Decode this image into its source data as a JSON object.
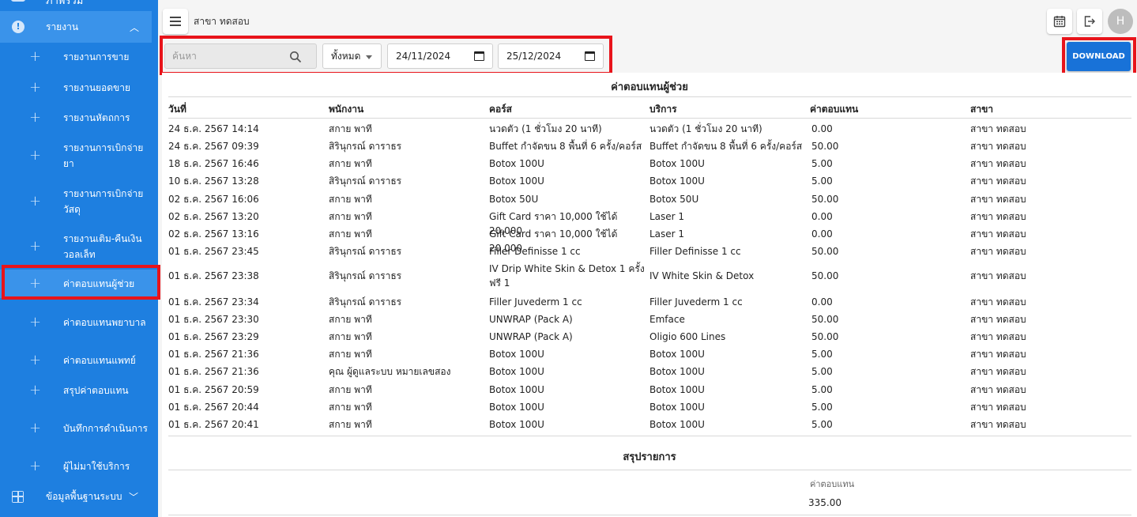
{
  "sidebar": {
    "top_partial_label": "ภาพรวม",
    "group_reports": "รายงาน",
    "items": [
      {
        "label": "รายงานการขาย"
      },
      {
        "label": "รายงานยอดขาย"
      },
      {
        "label": "รายงานหัตถการ"
      },
      {
        "label": "รายงานการเบิกจ่ายยา"
      },
      {
        "label": "รายงานการเบิกจ่ายวัสดุ"
      },
      {
        "label": "รายงานเติม-คืนเงินวอลเล็ท"
      },
      {
        "label": "ค่าตอบแทนผู้ช่วย"
      },
      {
        "label": "ค่าตอบแทนพยาบาล"
      },
      {
        "label": "ค่าตอบแทนแพทย์"
      },
      {
        "label": "สรุปค่าตอบแทน"
      },
      {
        "label": "บันทึกการดำเนินการ"
      },
      {
        "label": "ผู้ไม่มาใช้บริการ"
      }
    ],
    "group_master": "ข้อมูลพื้นฐานระบบ"
  },
  "header": {
    "branch": "สาขา ทดสอบ",
    "avatar_letter": "H"
  },
  "filters": {
    "search_placeholder": "ค้นหา",
    "select_value": "ทั้งหมด",
    "start_date": "24/11/2024",
    "end_date": "25/12/2024",
    "download_label": "DOWNLOAD"
  },
  "report": {
    "title": "ค่าตอบแทนผู้ช่วย",
    "columns": [
      "วันที่",
      "พนักงาน",
      "คอร์ส",
      "บริการ",
      "ค่าตอบแทน",
      "สาขา"
    ],
    "rows": [
      [
        "24 ธ.ค. 2567 14:14",
        "สกาย พาที",
        "นวดตัว (1 ชั่วโมง 20 นาที)",
        "นวดตัว (1 ชั่วโมง 20 นาที)",
        "0.00",
        "สาขา ทดสอบ"
      ],
      [
        "24 ธ.ค. 2567 09:39",
        "สิรินุกรณ์ ดาราธร",
        "Buffet กำจัดขน 8 พื้นที่ 6 ครั้ง/คอร์ส",
        "Buffet กำจัดขน 8 พื้นที่ 6 ครั้ง/คอร์ส",
        "50.00",
        "สาขา ทดสอบ"
      ],
      [
        "18 ธ.ค. 2567 16:46",
        "สกาย พาที",
        "Botox 100U",
        "Botox 100U",
        "5.00",
        "สาขา ทดสอบ"
      ],
      [
        "10 ธ.ค. 2567 13:28",
        "สิรินุกรณ์ ดาราธร",
        "Botox 100U",
        "Botox 100U",
        "5.00",
        "สาขา ทดสอบ"
      ],
      [
        "02 ธ.ค. 2567 16:06",
        "สกาย พาที",
        "Botox 50U",
        "Botox 50U",
        "50.00",
        "สาขา ทดสอบ"
      ],
      [
        "02 ธ.ค. 2567 13:20",
        "สกาย พาที",
        "Gift Card ราคา 10,000 ใช้ได้ 20,000",
        "Laser 1",
        "0.00",
        "สาขา ทดสอบ"
      ],
      [
        "02 ธ.ค. 2567 13:16",
        "สกาย พาที",
        "Gift Card ราคา 10,000 ใช้ได้ 20,000",
        "Laser 1",
        "0.00",
        "สาขา ทดสอบ"
      ],
      [
        "01 ธ.ค. 2567 23:45",
        "สิรินุกรณ์ ดาราธร",
        "Filler Definisse 1 cc",
        "Filler Definisse 1 cc",
        "50.00",
        "สาขา ทดสอบ"
      ],
      [
        "01 ธ.ค. 2567 23:38",
        "สิรินุกรณ์ ดาราธร",
        "IV Drip White Skin & Detox 1 ครั้ง ฟรี 1",
        "IV White Skin & Detox",
        "50.00",
        "สาขา ทดสอบ"
      ],
      [
        "01 ธ.ค. 2567 23:34",
        "สิรินุกรณ์ ดาราธร",
        "Filler Juvederm 1 cc",
        "Filler Juvederm 1 cc",
        "0.00",
        "สาขา ทดสอบ"
      ],
      [
        "01 ธ.ค. 2567 23:30",
        "สกาย พาที",
        "UNWRAP (Pack A)",
        "Emface",
        "50.00",
        "สาขา ทดสอบ"
      ],
      [
        "01 ธ.ค. 2567 23:29",
        "สกาย พาที",
        "UNWRAP (Pack A)",
        "Oligio 600 Lines",
        "50.00",
        "สาขา ทดสอบ"
      ],
      [
        "01 ธ.ค. 2567 21:36",
        "สกาย พาที",
        "Botox 100U",
        "Botox 100U",
        "5.00",
        "สาขา ทดสอบ"
      ],
      [
        "01 ธ.ค. 2567 21:36",
        "คุณ ผู้ดูแลระบบ หมายเลขสอง",
        "Botox 100U",
        "Botox 100U",
        "5.00",
        "สาขา ทดสอบ"
      ],
      [
        "01 ธ.ค. 2567 20:59",
        "สกาย พาที",
        "Botox 100U",
        "Botox 100U",
        "5.00",
        "สาขา ทดสอบ"
      ],
      [
        "01 ธ.ค. 2567 20:44",
        "สกาย พาที",
        "Botox 100U",
        "Botox 100U",
        "5.00",
        "สาขา ทดสอบ"
      ],
      [
        "01 ธ.ค. 2567 20:41",
        "สกาย พาที",
        "Botox 100U",
        "Botox 100U",
        "5.00",
        "สาขา ทดสอบ"
      ]
    ],
    "summary_title": "สรุปรายการ",
    "summary_label": "ค่าตอบแทน",
    "summary_value": "335.00"
  },
  "colors": {
    "sidebar": "#1e7fe0",
    "sidebar_active": "#3a93ea",
    "download": "#1872d8",
    "highlight": "#e8141b"
  }
}
